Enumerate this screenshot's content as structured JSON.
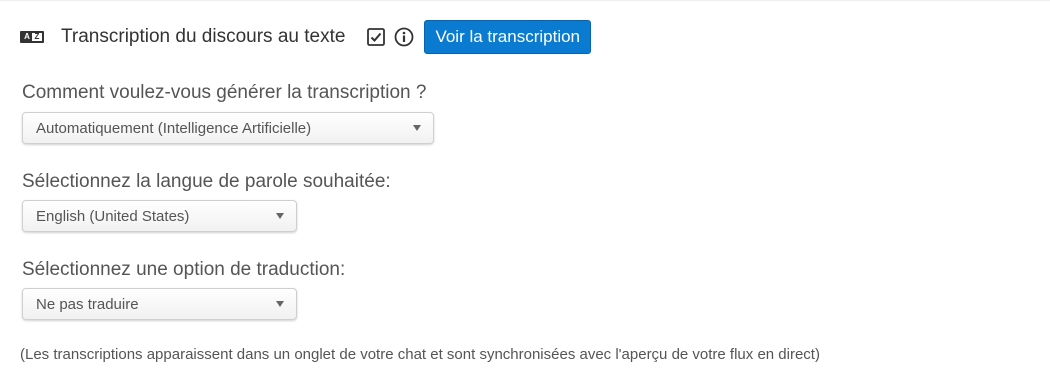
{
  "header": {
    "title": "Transcription du discours au texte",
    "title_icon": "translate-az-icon",
    "checkbox_icon": "checkbox-checked-icon",
    "info_icon": "info-icon",
    "view_button_label": "Voir la transcription",
    "accent_color": "#0a7bd1"
  },
  "fields": {
    "method": {
      "label": "Comment voulez-vous générer la transcription ?",
      "selected": "Automatiquement (Intelligence Artificielle)"
    },
    "language": {
      "label": "Sélectionnez la langue de parole souhaitée:",
      "selected": "English (United States)"
    },
    "translation": {
      "label": "Sélectionnez une option de traduction:",
      "selected": "Ne pas traduire"
    }
  },
  "footnote": "(Les transcriptions apparaissent dans un onglet de votre chat et sont synchronisées avec l'aperçu de votre flux en direct)"
}
